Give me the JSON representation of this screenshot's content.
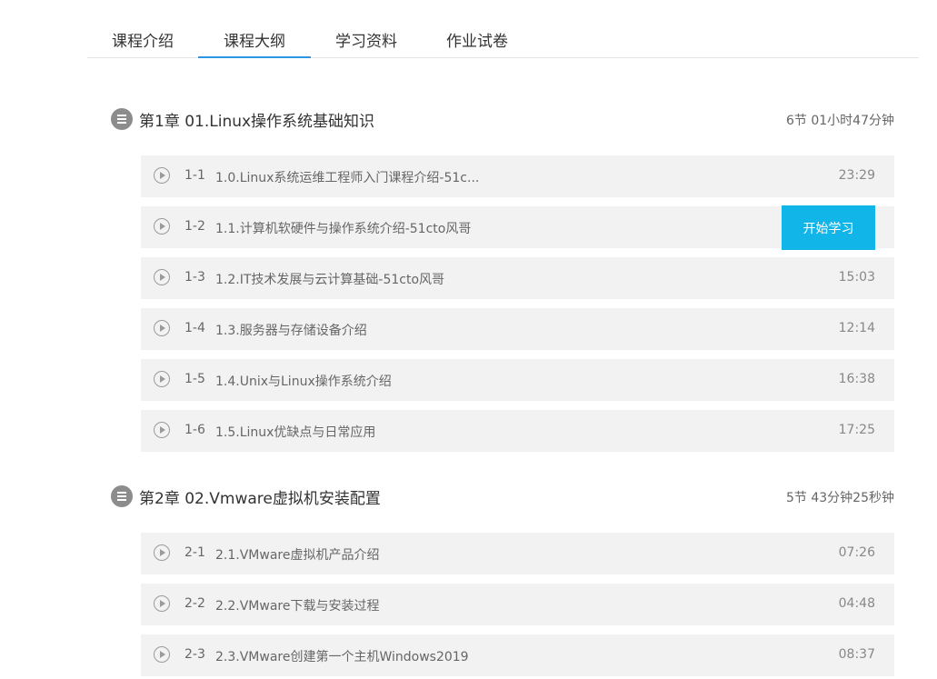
{
  "tabs": [
    {
      "label": "课程介绍",
      "active": false
    },
    {
      "label": "课程大纲",
      "active": true
    },
    {
      "label": "学习资料",
      "active": false
    },
    {
      "label": "作业试卷",
      "active": false
    }
  ],
  "colors": {
    "active_tab_underline": "#2a97e0",
    "start_button": "#12b5e8",
    "lesson_bg": "#f2f2f2"
  },
  "chapters": [
    {
      "title": "第1章  01.Linux操作系统基础知识",
      "meta": "6节 01小时47分钟",
      "icon": "list-icon",
      "lessons": [
        {
          "num": "1-1",
          "title": "1.0.Linux系统运维工程师入门课程介绍-51c...",
          "time": "23:29"
        },
        {
          "num": "1-2",
          "title": "1.1.计算机软硬件与操作系统介绍-51cto风哥",
          "time": "",
          "button": "开始学习"
        },
        {
          "num": "1-3",
          "title": "1.2.IT技术发展与云计算基础-51cto风哥",
          "time": "15:03"
        },
        {
          "num": "1-4",
          "title": "1.3.服务器与存储设备介绍",
          "time": "12:14"
        },
        {
          "num": "1-5",
          "title": "1.4.Unix与Linux操作系统介绍",
          "time": "16:38"
        },
        {
          "num": "1-6",
          "title": "1.5.Linux优缺点与日常应用",
          "time": "17:25"
        }
      ]
    },
    {
      "title": "第2章  02.Vmware虚拟机安装配置",
      "meta": "5节 43分钟25秒钟",
      "icon": "list-icon",
      "lessons": [
        {
          "num": "2-1",
          "title": "2.1.VMware虚拟机产品介绍",
          "time": "07:26"
        },
        {
          "num": "2-2",
          "title": "2.2.VMware下载与安装过程",
          "time": "04:48"
        },
        {
          "num": "2-3",
          "title": "2.3.VMware创建第一个主机Windows2019",
          "time": "08:37"
        }
      ]
    }
  ]
}
